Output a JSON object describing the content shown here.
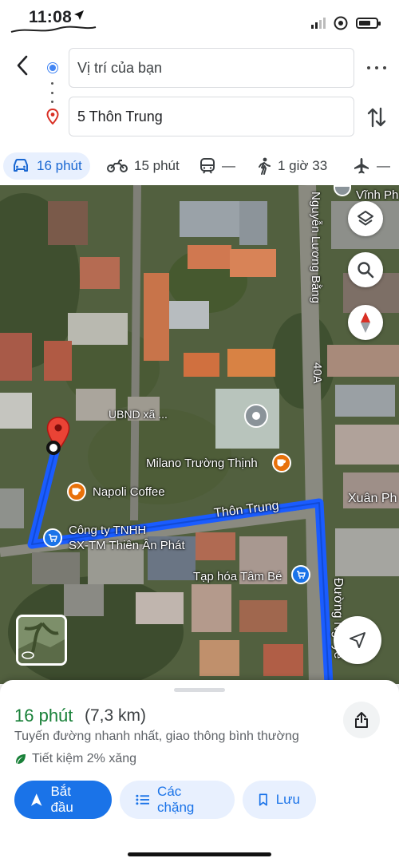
{
  "status_bar": {
    "time": "11:08"
  },
  "directions": {
    "origin_value": "Vị trí của bạn",
    "destination_value": "5 Thôn Trung"
  },
  "modes": [
    {
      "name": "car",
      "label": "16 phút",
      "selected": true
    },
    {
      "name": "motorbike",
      "label": "15 phút"
    },
    {
      "name": "transit",
      "label": "—"
    },
    {
      "name": "walk",
      "label": "1 giờ 33"
    },
    {
      "name": "flight",
      "label": "—"
    }
  ],
  "map": {
    "labels": {
      "nguyen_luong_bang": "Nguyễn Lương Bằng",
      "road_40a": "40A",
      "vinh_phu": "Vĩnh Ph",
      "ubnd": "UBND xã ...",
      "milano": "Milano Trường Thịnh",
      "napoli": "Napoli Coffee",
      "thon_trung": "Thôn Trung",
      "xuan_phu": "Xuân Ph",
      "cong_ty_line1": "Công ty TNHH",
      "cong_ty_line2": "SX-TM Thiên Ân Phát",
      "tap_hoa": "Tạp hóa Tâm Bé",
      "duong_nguyen": "Đường Nguyễ"
    },
    "route_color": "#1a5cff"
  },
  "summary": {
    "duration": "16 phút",
    "distance": "(7,3 km)",
    "description": "Tuyến đường nhanh nhất, giao thông bình thường",
    "fuel_saving": "Tiết kiệm 2% xăng"
  },
  "actions": {
    "start": "Bắt đầu",
    "steps": "Các chặng",
    "save": "Lưu"
  }
}
